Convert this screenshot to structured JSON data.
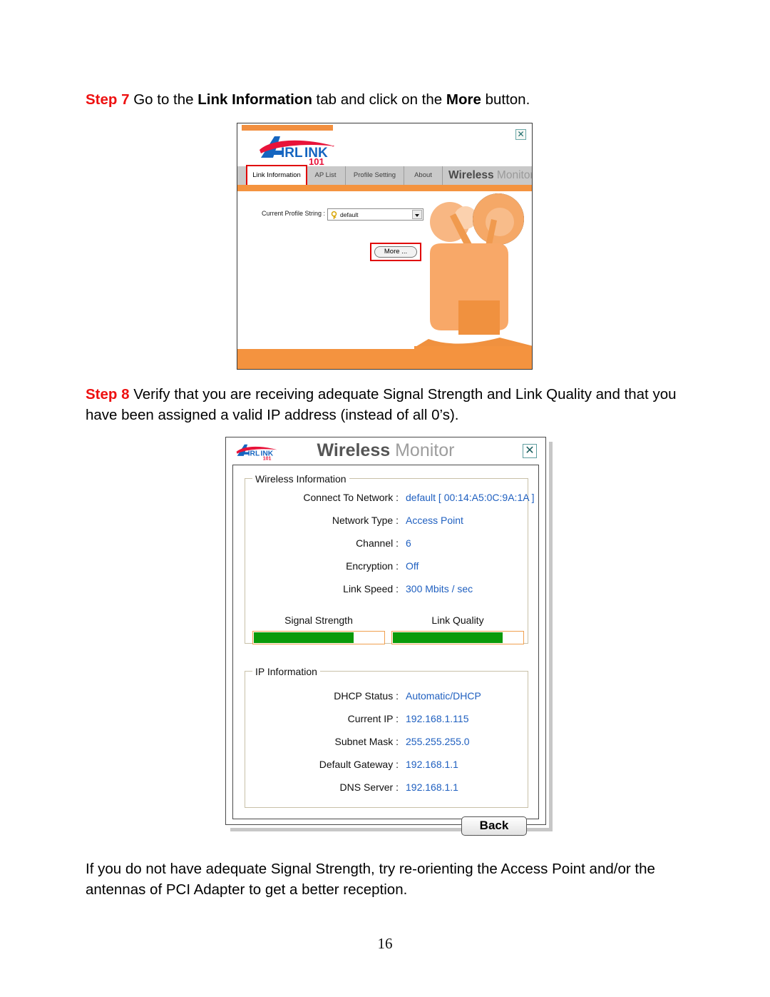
{
  "document": {
    "page_number": "16",
    "step7": {
      "step_label": "Step 7",
      "text_part1": " Go to the ",
      "bold1": "Link Information",
      "text_part2": " tab and click on the ",
      "bold2": "More",
      "text_part3": " button."
    },
    "step8": {
      "step_label": "Step 8",
      "text": " Verify that you are receiving adequate Signal Strength and Link Quality and that you have been assigned a valid IP address (instead of all 0’s)."
    },
    "closing_text": "If you do not have adequate Signal Strength, try re-orienting the Access Point and/or the antennas of PCI Adapter to get a better reception."
  },
  "window1": {
    "brand_bold": "Wireless",
    "brand_light": " Monitor",
    "close_label": "✕",
    "logo_alt": "airlink-101-logo",
    "tabs": [
      {
        "id": "link-information",
        "label": "Link Information",
        "active": true
      },
      {
        "id": "ap-list",
        "label": "AP List",
        "active": false
      },
      {
        "id": "profile-setting",
        "label": "Profile Setting",
        "active": false
      },
      {
        "id": "about",
        "label": "About",
        "active": false
      }
    ],
    "profile": {
      "label": "Current Profile String :",
      "value": "default",
      "icon": "profile-key-icon"
    },
    "more_button": "More ...",
    "highlight_color": "#e00000",
    "accent_color": "#f4933f"
  },
  "window2": {
    "title_bold": "Wireless",
    "title_light": " Monitor",
    "close_label": "✕",
    "logo_alt": "airlink-101-logo",
    "wireless_group": {
      "title": "Wireless Information",
      "rows": [
        {
          "label": "Connect To Network :",
          "value": "default [ 00:14:A5:0C:9A:1A ]"
        },
        {
          "label": "Network Type :",
          "value": "Access Point"
        },
        {
          "label": "Channel :",
          "value": "6"
        },
        {
          "label": "Encryption :",
          "value": "Off"
        },
        {
          "label": "Link Speed :",
          "value": "300 Mbits / sec"
        }
      ],
      "meters": [
        {
          "caption": "Signal Strength",
          "percent": 77
        },
        {
          "caption": "Link Quality",
          "percent": 85
        }
      ]
    },
    "ip_group": {
      "title": "IP Information",
      "rows": [
        {
          "label": "DHCP Status :",
          "value": "Automatic/DHCP"
        },
        {
          "label": "Current IP :",
          "value": "192.168.1.115"
        },
        {
          "label": "Subnet Mask :",
          "value": "255.255.255.0"
        },
        {
          "label": "Default Gateway :",
          "value": "192.168.1.1"
        },
        {
          "label": "DNS Server :",
          "value": "192.168.1.1"
        }
      ]
    },
    "back_button": "Back",
    "value_color": "#2060c0",
    "meter_fill_color": "#0a9a0a",
    "meter_border_color": "#f0a050"
  }
}
